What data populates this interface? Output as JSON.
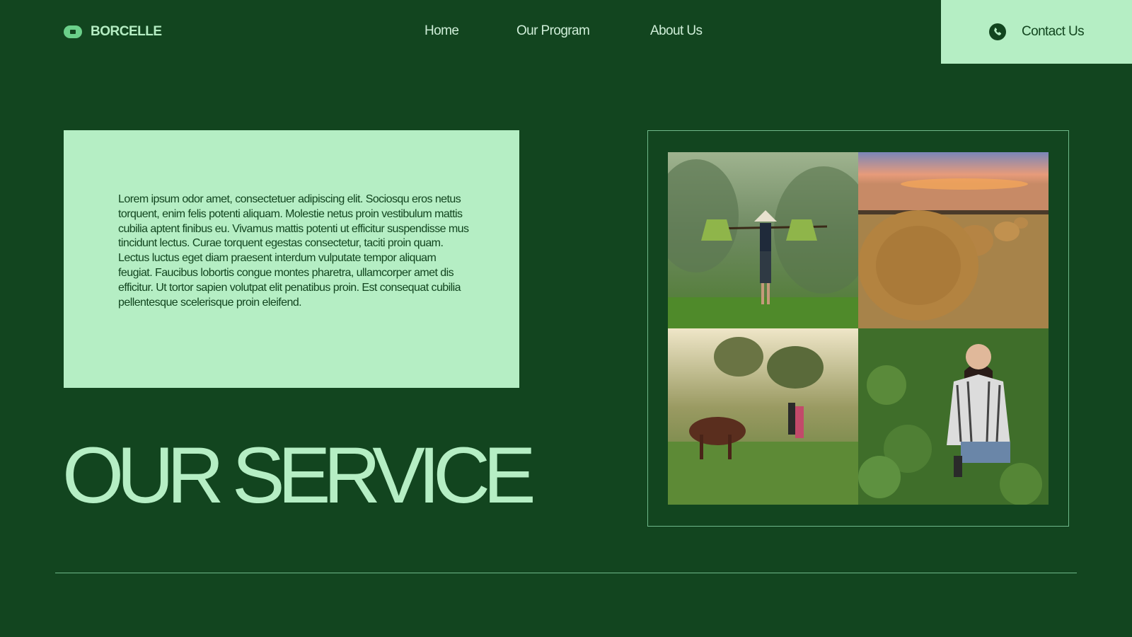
{
  "brand": {
    "name": "BORCELLE"
  },
  "nav": {
    "items": [
      {
        "label": "Home"
      },
      {
        "label": "Our Program"
      },
      {
        "label": "About Us"
      }
    ],
    "contact_label": "Contact Us"
  },
  "intro": {
    "body": "Lorem ipsum odor amet, consectetuer adipiscing elit. Sociosqu eros netus torquent, enim felis potenti aliquam. Molestie netus proin vestibulum mattis cubilia aptent finibus eu. Vivamus mattis potenti ut efficitur suspendisse mus tincidunt lectus. Curae torquent egestas consectetur, taciti proin quam. Lectus luctus eget diam praesent interdum vulputate tempor aliquam feugiat. Faucibus lobortis congue montes pharetra, ullamcorper amet dis efficitur. Ut tortor sapien volutpat elit penatibus proin. Est consequat cubilia pellentesque scelerisque proin eleifend."
  },
  "headline": "OUR SERVICE",
  "colors": {
    "background": "#12451f",
    "accent_light": "#b5eec4",
    "accent_mid": "#6bd08a"
  },
  "icons": {
    "logo": "logo-mark-icon",
    "contact": "phone-icon"
  }
}
